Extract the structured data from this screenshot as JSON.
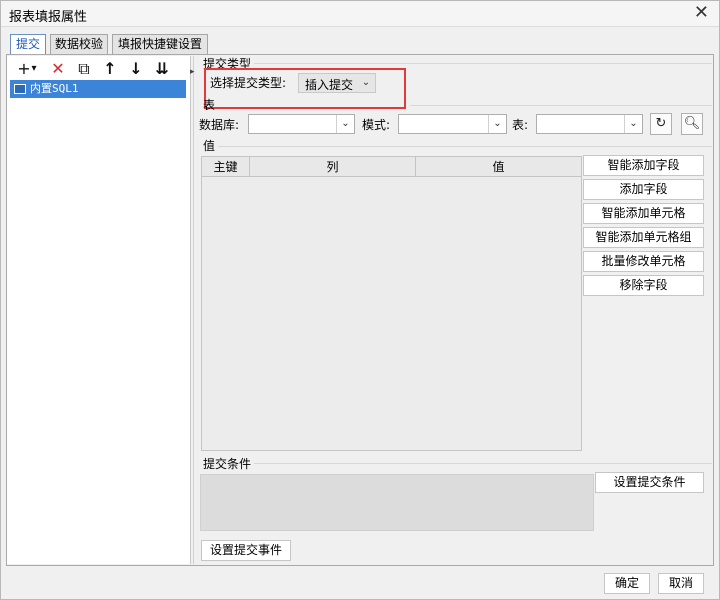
{
  "window": {
    "title": "报表填报属性",
    "close_glyph": "✕"
  },
  "tabs": [
    {
      "label": "提交",
      "active": true
    },
    {
      "label": "数据校验",
      "active": false
    },
    {
      "label": "填报快捷键设置",
      "active": false
    }
  ],
  "toolbar": {
    "add_glyph": "+",
    "add_menu_glyph": "▾",
    "delete_glyph": "✕",
    "copy_glyph": "⧉",
    "up_glyph": "↑",
    "down_glyph": "↓",
    "bottom_glyph": "⇊"
  },
  "tree": {
    "items": [
      {
        "label": "内置SQL1",
        "icon": "table-icon",
        "selected": true
      }
    ]
  },
  "submit_type": {
    "section_label": "提交类型",
    "field_label": "选择提交类型:",
    "value": "插入提交",
    "highlight_color": "#e23a3a"
  },
  "table_section": {
    "section_label": "表",
    "database_label": "数据库:",
    "database_value": "",
    "schema_label": "模式:",
    "schema_value": "",
    "table_label": "表:",
    "table_value": "",
    "refresh_icon": "refresh-icon",
    "preview_icon": "preview-icon"
  },
  "values_section": {
    "section_label": "值",
    "columns": [
      "主键",
      "列",
      "值"
    ],
    "rows": [],
    "buttons": [
      "智能添加字段",
      "添加字段",
      "智能添加单元格",
      "智能添加单元格组",
      "批量修改单元格",
      "移除字段"
    ]
  },
  "condition_section": {
    "section_label": "提交条件",
    "set_condition_button": "设置提交条件"
  },
  "event_button": "设置提交事件",
  "footer": {
    "ok": "确定",
    "cancel": "取消"
  },
  "colors": {
    "selection": "#3c84d8",
    "active_tab_text": "#1c57b8",
    "delete_icon": "#d9282e"
  }
}
